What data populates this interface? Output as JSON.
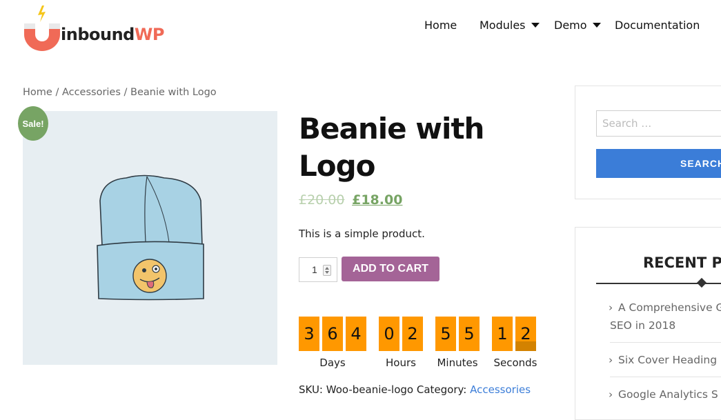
{
  "header": {
    "logo_text_main": "inbound",
    "logo_text_accent": "WP",
    "nav": [
      {
        "label": "Home",
        "has_dropdown": false
      },
      {
        "label": "Modules",
        "has_dropdown": true
      },
      {
        "label": "Demo",
        "has_dropdown": true
      },
      {
        "label": "Documentation",
        "has_dropdown": false
      }
    ]
  },
  "breadcrumb": {
    "home": "Home",
    "sep": "/",
    "category": "Accessories",
    "current": "Beanie with Logo"
  },
  "product": {
    "sale_badge": "Sale!",
    "title": "Beanie with Logo",
    "old_price": "£20.00",
    "new_price": "£18.00",
    "description": "This is a simple product.",
    "quantity": "1",
    "add_to_cart": "ADD TO CART",
    "sku_label": "SKU:",
    "sku": "Woo-beanie-logo",
    "category_label": "Category:",
    "category": "Accessories"
  },
  "countdown": {
    "days": [
      "3",
      "6",
      "4"
    ],
    "hours": [
      "0",
      "2"
    ],
    "minutes": [
      "5",
      "5"
    ],
    "seconds": [
      "1",
      "2"
    ],
    "labels": {
      "days": "Days",
      "hours": "Hours",
      "minutes": "Minutes",
      "seconds": "Seconds"
    },
    "color": "#ff9800"
  },
  "sidebar": {
    "search_placeholder": "Search …",
    "search_button": "SEARCH",
    "recent_title": "RECENT PO",
    "recent_posts": [
      {
        "line1": "A Comprehensive G",
        "line2": "SEO in 2018"
      },
      {
        "line1": "Six Cover Heading S"
      },
      {
        "line1": "Google Analytics S"
      }
    ]
  },
  "colors": {
    "sale_green": "#77a464",
    "cart_purple": "#a46497",
    "link_blue": "#3b7dd8",
    "logo_coral": "#f06a57"
  }
}
